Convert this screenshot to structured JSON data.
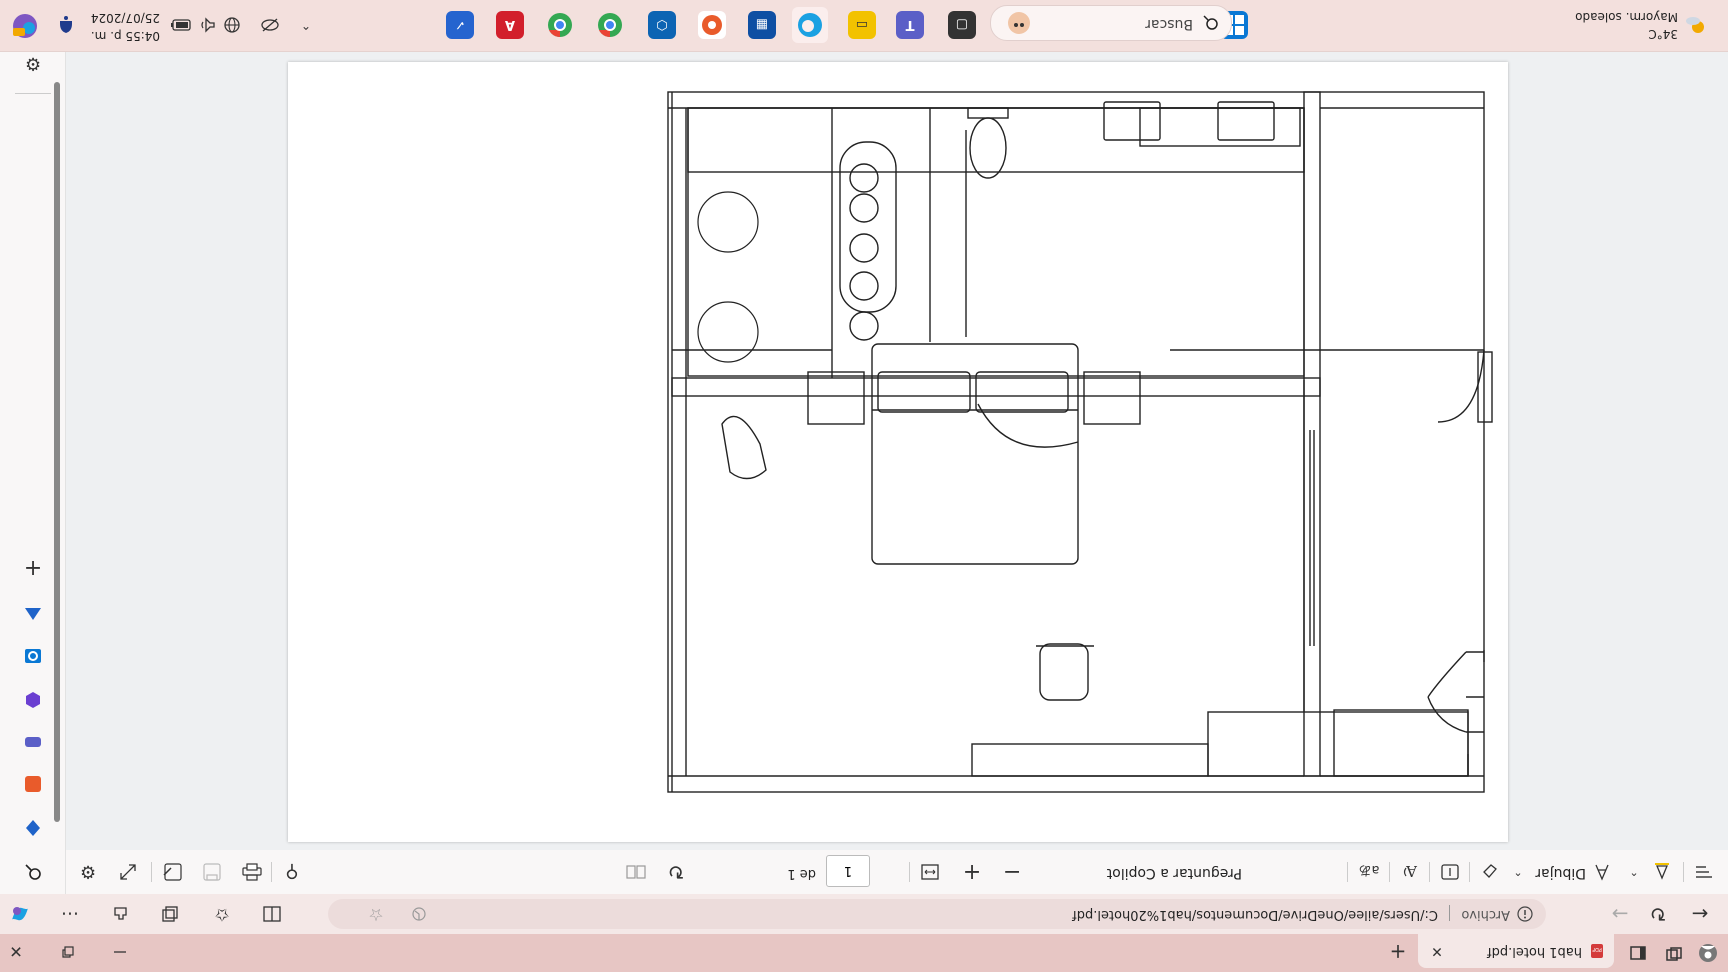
{
  "browser": {
    "tab_title": "hab1 hotel.pdf",
    "address_label": "Archivo",
    "address_path": "C:/Users/ailee/OneDrive/Documentos/hab1%20hotel.pdf"
  },
  "pdf_toolbar": {
    "draw_label": "Dibujar",
    "copilot_label": "Preguntar a Copilot",
    "page_current": "1",
    "page_total_label": "de 1"
  },
  "taskbar": {
    "weather_temp": "34°C",
    "weather_desc": "Mayorm. soleado",
    "search_placeholder": "Buscar",
    "time": "04:55 p. m.",
    "date": "25/07/2024"
  },
  "colors": {
    "tab_bar": "#e7c6c4",
    "address_bar": "#f4e8e7",
    "taskbar": "#f3e0dd",
    "accent_blue": "#0a78d4"
  },
  "icons": {
    "sidebar": [
      "search-icon",
      "drop-icon",
      "office-icon",
      "outlook-icon",
      "sharepoint-icon",
      "add-icon",
      "settings-icon"
    ],
    "taskbar": [
      "windows-start-icon",
      "search-icon",
      "copilot-icon",
      "terminal-icon",
      "teams-icon",
      "file-explorer-icon",
      "edge-icon",
      "store-icon",
      "office-icon",
      "chrome-icon",
      "chrome-profile-icon",
      "acrobat-icon",
      "todo-icon"
    ]
  }
}
